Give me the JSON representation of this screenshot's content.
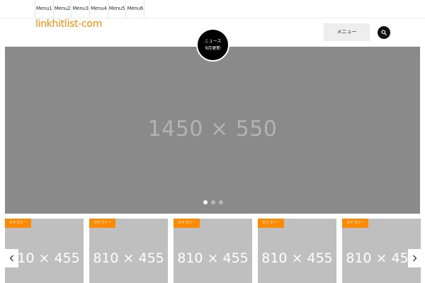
{
  "top_menu": [
    "Menu1",
    "Menu2",
    "Menu3",
    "Menu4",
    "Menu5",
    "Menu6"
  ],
  "site_logo": "linkhitlist-com",
  "header_button": "メニュー",
  "circle_badge": {
    "line1": "ニュース",
    "line2": "9月更新"
  },
  "hero": {
    "placeholder": "1450 × 550",
    "dots": 3,
    "active_dot": 0
  },
  "cards": [
    {
      "tag": "カテゴリー",
      "placeholder": "810 × 455"
    },
    {
      "tag": "カテゴリー",
      "placeholder": "810 × 455"
    },
    {
      "tag": "カテゴリー",
      "placeholder": "810 × 455"
    },
    {
      "tag": "カテゴリー",
      "placeholder": "810 × 455"
    },
    {
      "tag": "カテゴリー",
      "placeholder": "810 × 455"
    }
  ],
  "colors": {
    "accent": "#ff8a00",
    "hero_bg": "#8a8a8a",
    "card_bg": "#bfbfbf"
  },
  "icons": {
    "search": "search-icon",
    "prev": "chevron-left-icon",
    "next": "chevron-right-icon"
  }
}
